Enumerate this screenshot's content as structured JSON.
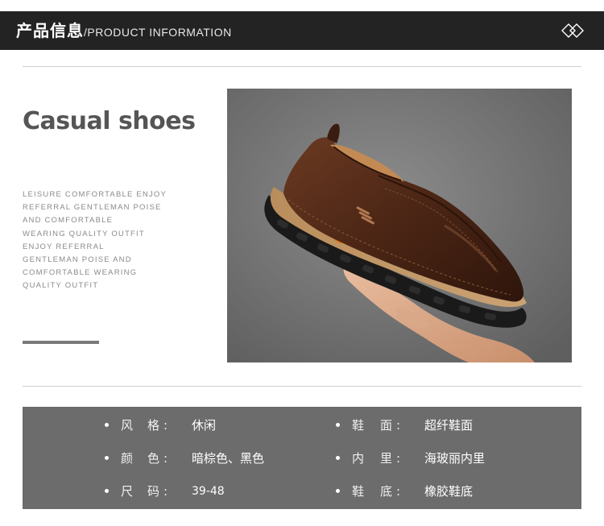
{
  "header": {
    "title_cn": "产品信息",
    "title_en": "/PRODUCT INFORMATION",
    "icon": "double-diamond-icon"
  },
  "hero": {
    "title": "Casual shoes",
    "lines": [
      "LEISURE COMFORTABLE ENJOY",
      "REFERRAL GENTLEMAN POISE",
      "AND COMFORTABLE",
      "WEARING QUALITY OUTFIT",
      "ENJOY REFERRAL",
      "GENTLEMAN POISE AND",
      "COMFORTABLE WEARING",
      "QUALITY OUTFIT"
    ]
  },
  "photo": {
    "subject": "brown-leather-slip-on-shoe-image"
  },
  "specs": {
    "rows": [
      {
        "left": {
          "label_a": "风",
          "label_b": "格",
          "colon": ":",
          "value": "休闲"
        },
        "right": {
          "label_a": "鞋",
          "label_b": "面",
          "colon": ":",
          "value": "超纤鞋面"
        }
      },
      {
        "left": {
          "label_a": "颜",
          "label_b": "色",
          "colon": ":",
          "value": "暗棕色、黑色"
        },
        "right": {
          "label_a": "内",
          "label_b": "里",
          "colon": ":",
          "value": "海玻丽内里"
        }
      },
      {
        "left": {
          "label_a": "尺",
          "label_b": "码",
          "colon": ":",
          "value": "39-48"
        },
        "right": {
          "label_a": "鞋",
          "label_b": "底",
          "colon": ":",
          "value": "橡胶鞋底"
        }
      }
    ]
  },
  "colors": {
    "header_bg": "#232323",
    "title_gray": "#555555",
    "specs_bg": "#6c6c6c"
  }
}
